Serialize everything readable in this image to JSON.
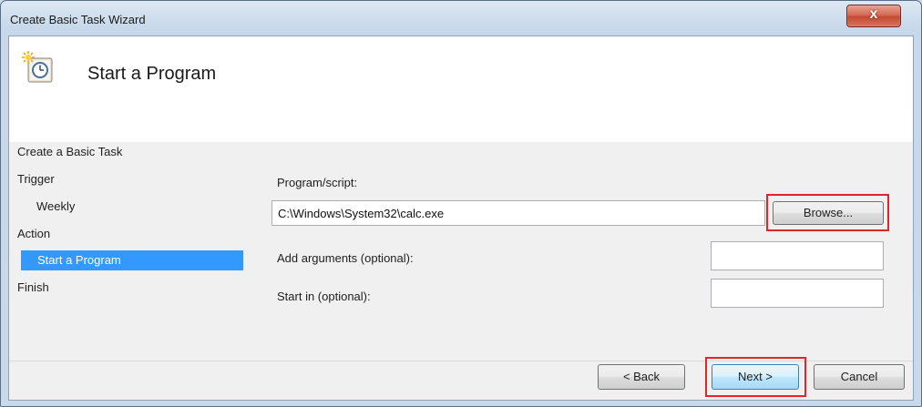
{
  "window": {
    "title": "Create Basic Task Wizard",
    "close_label": "x"
  },
  "header": {
    "title": "Start a Program",
    "icon": "task-clock-icon"
  },
  "nav": {
    "heading": "Create a Basic Task",
    "items": [
      {
        "label": "Trigger",
        "level": 0,
        "selected": false
      },
      {
        "label": "Weekly",
        "level": 1,
        "selected": false
      },
      {
        "label": "Action",
        "level": 0,
        "selected": false
      },
      {
        "label": "Start a Program",
        "level": 1,
        "selected": true
      },
      {
        "label": "Finish",
        "level": 0,
        "selected": false
      }
    ]
  },
  "form": {
    "program_label": "Program/script:",
    "program_value": "C:\\Windows\\System32\\calc.exe",
    "browse_label": "Browse...",
    "arguments_label": "Add arguments (optional):",
    "arguments_value": "",
    "start_in_label": "Start in (optional):",
    "start_in_value": ""
  },
  "footer": {
    "back_label": "< Back",
    "next_label": "Next >",
    "cancel_label": "Cancel"
  },
  "colors": {
    "selection": "#3399ff",
    "highlight_box": "#e0262b"
  }
}
